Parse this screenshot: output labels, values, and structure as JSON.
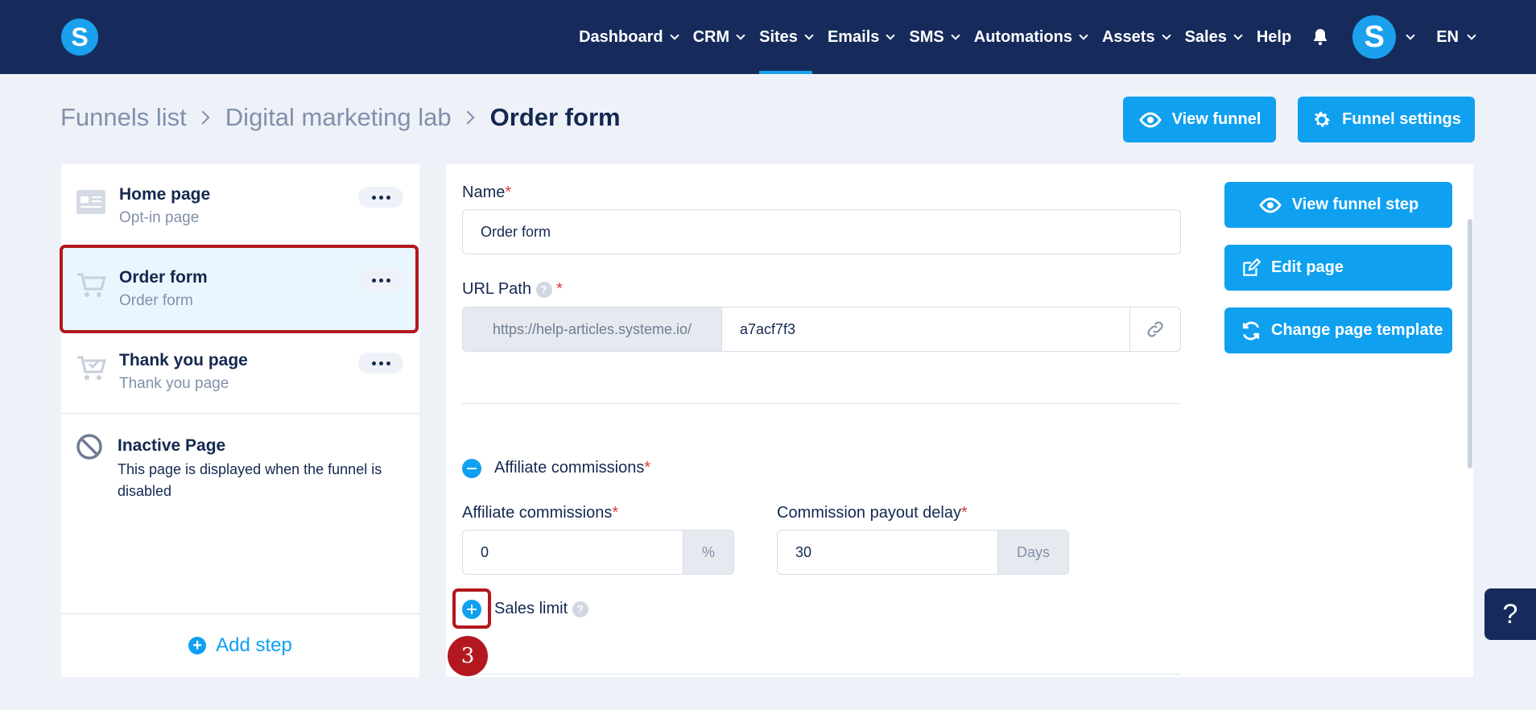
{
  "nav": {
    "items": [
      {
        "label": "Dashboard"
      },
      {
        "label": "CRM"
      },
      {
        "label": "Sites"
      },
      {
        "label": "Emails"
      },
      {
        "label": "SMS"
      },
      {
        "label": "Automations"
      },
      {
        "label": "Assets"
      },
      {
        "label": "Sales"
      }
    ],
    "help_label": "Help",
    "avatar_letter": "S",
    "logo_letter": "S",
    "language": "EN",
    "active_item": "Sites"
  },
  "breadcrumb": {
    "items": [
      "Funnels list",
      "Digital marketing lab"
    ],
    "current": "Order form"
  },
  "header_buttons": {
    "view_funnel": "View funnel",
    "funnel_settings": "Funnel settings"
  },
  "steps": [
    {
      "title": "Home page",
      "subtitle": "Opt-in page",
      "icon": "page-layout-icon"
    },
    {
      "title": "Order form",
      "subtitle": "Order form",
      "icon": "shopping-cart-icon"
    },
    {
      "title": "Thank you page",
      "subtitle": "Thank you page",
      "icon": "cart-check-icon"
    }
  ],
  "inactive_page": {
    "title": "Inactive Page",
    "description": "This page is displayed when the funnel is disabled"
  },
  "add_step_label": "Add step",
  "form": {
    "name_label": "Name",
    "name_value": "Order form",
    "url_path_label": "URL Path",
    "url_prefix": "https://help-articles.systeme.io/",
    "url_value": "a7acf7f3",
    "affiliate_section_label": "Affiliate commissions",
    "affiliate_commissions_label": "Affiliate commissions",
    "affiliate_commissions_value": "0",
    "affiliate_unit": "%",
    "payout_delay_label": "Commission payout delay",
    "payout_delay_value": "30",
    "payout_unit": "Days",
    "sales_limit_label": "Sales limit",
    "required_mark": "*",
    "help_mark": "?"
  },
  "side_actions": {
    "view_funnel_step": "View funnel step",
    "edit_page": "Edit page",
    "change_page_template": "Change page template"
  },
  "annotation_step_number": "3",
  "help_fab_label": "?",
  "colors": {
    "nav_bg": "#162b5c",
    "accent": "#0fa0f0",
    "highlight": "#b3181e",
    "page_bg": "#eef2f8"
  }
}
